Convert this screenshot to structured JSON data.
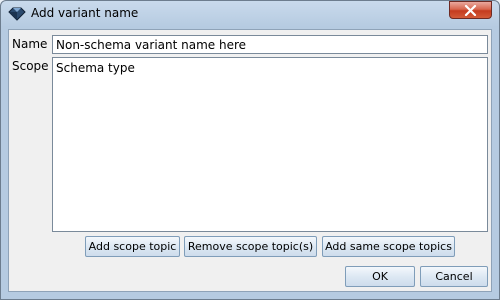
{
  "window": {
    "title": "Add variant name"
  },
  "form": {
    "name_label": "Name",
    "name_value": "Non-schema variant name here",
    "scope_label": "Scope",
    "scope_value": "Schema type"
  },
  "scope_buttons": {
    "add": "Add scope topic",
    "remove": "Remove scope topic(s)",
    "add_same": "Add same scope topics"
  },
  "footer": {
    "ok": "OK",
    "cancel": "Cancel"
  },
  "icons": {
    "app": "diamond-icon",
    "close": "close-icon"
  }
}
